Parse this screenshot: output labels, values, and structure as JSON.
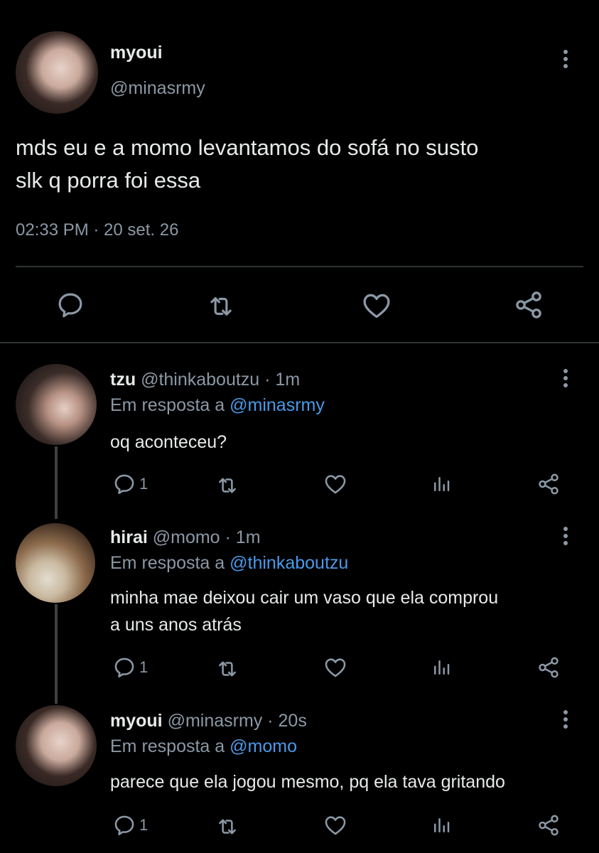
{
  "main_tweet": {
    "name": "myoui",
    "handle": "@minasrmy",
    "text_line1": "mds eu e a momo levantamos do sofá no susto",
    "text_line2": "slk q porra foi essa",
    "timestamp": "02:33 PM · 20 set. 26",
    "actions": [
      "reply-icon",
      "retweet-icon",
      "like-icon",
      "share-icon"
    ]
  },
  "replies": [
    {
      "name": "tzu",
      "meta": "@thinkaboutzu · 1m",
      "reply_prefix": "Em resposta a",
      "reply_to": "@minasrmy",
      "text_line1": "oq aconteceu?",
      "text_line2": "",
      "reply_count": "1"
    },
    {
      "name": "hirai",
      "meta": "@momo · 1m",
      "reply_prefix": "Em resposta a",
      "reply_to": "@thinkaboutzu",
      "text_line1": "minha mae deixou cair um vaso que ela comprou",
      "text_line2": "a uns anos atrás",
      "reply_count": "1"
    },
    {
      "name": "myoui",
      "meta": "@minasrmy · 20s",
      "reply_prefix": "Em resposta a",
      "reply_to": "@momo",
      "text_line1": "parece que ela jogou mesmo, pq ela tava gritando",
      "text_line2": "",
      "reply_count": "1"
    }
  ],
  "colors": {
    "background": "#000000",
    "text": "#e7e9ea",
    "secondary": "#8b98a5",
    "link": "#4a99e9",
    "divider": "#2f3336"
  }
}
